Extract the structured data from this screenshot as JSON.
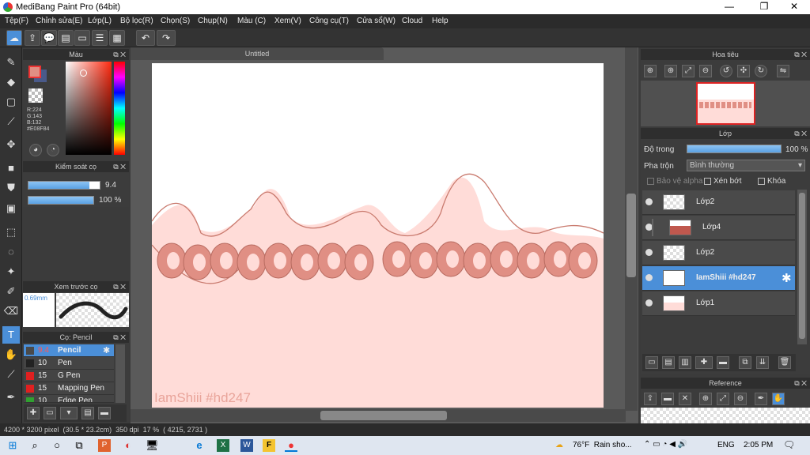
{
  "titlebar": {
    "title": "MediBang Paint Pro (64bit)",
    "minimize": "—",
    "maximize": "❐",
    "close": "✕"
  },
  "menu": [
    "Tệp(F)",
    "Chỉnh sửa(E)",
    "Lớp(L)",
    "Bộ lọc(R)",
    "Chọn(S)",
    "Chụp(N)",
    "Màu (C)",
    "Xem(V)",
    "Công cụ(T)",
    "Cửa sổ(W)",
    "Cloud",
    "Help"
  ],
  "color_panel": {
    "title": "Màu",
    "r": "R:224",
    "g": "G:143",
    "b": "B:132",
    "hex": "#E08F84",
    "primary_color": "#e08f84",
    "secondary_color": "#4a5a8a"
  },
  "brush_control": {
    "title": "Kiểm soát cọ",
    "size": "9.4",
    "opacity": "100 %",
    "size_fraction": 0.86,
    "opacity_fraction": 1.0
  },
  "brush_preview": {
    "title": "Xem trước cọ",
    "size_label": "0.69mm"
  },
  "brush_list": {
    "title": "Cọ: Pencil",
    "items": [
      {
        "size": "9.4",
        "name": "Pencil",
        "color": "#4a4a4a"
      },
      {
        "size": "10",
        "name": "Pen",
        "color": "#222222"
      },
      {
        "size": "15",
        "name": "G Pen",
        "color": "#e02020"
      },
      {
        "size": "15",
        "name": "Mapping Pen",
        "color": "#e02020"
      },
      {
        "size": "10",
        "name": "Edge Pen",
        "color": "#30a030"
      }
    ]
  },
  "document": {
    "tab": "Untitled",
    "watermark": "IamShiii #hd247"
  },
  "navigator": {
    "title": "Hoa tiêu"
  },
  "layer_panel": {
    "title": "Lớp",
    "opacity_label": "Độ trong",
    "opacity_value": "100 %",
    "opacity_fraction": 1.0,
    "blend_label": "Pha trộn",
    "blend_value": "Bình thường",
    "protect_alpha": "Bảo vệ alpha",
    "clipping": "Xén bớt",
    "lock": "Khóa",
    "layers": [
      {
        "name": "Lớp2",
        "selected": false,
        "indent": false
      },
      {
        "name": "Lớp4",
        "selected": false,
        "indent": true
      },
      {
        "name": "Lớp2",
        "selected": false,
        "indent": false
      },
      {
        "name": "IamShiii #hd247",
        "selected": true,
        "indent": false
      },
      {
        "name": "Lớp1",
        "selected": false,
        "indent": false
      }
    ]
  },
  "reference": {
    "title": "Reference"
  },
  "status": {
    "text": "4200 * 3200 pixel  (30.5 * 23.2cm)  350 dpi  17 %  ( 4215, 2731 )"
  },
  "taskbar": {
    "weather": "76°F  Rain sho...",
    "lang": "ENG",
    "time": "2:05 PM",
    "apps": [
      "P",
      "◐",
      "🖥",
      "e",
      "X",
      "W",
      "F",
      "●"
    ]
  },
  "colors": {
    "accent": "#4b8fd8",
    "pink_bg": "#ffdcd8",
    "pink_letters": "#e08f84"
  }
}
